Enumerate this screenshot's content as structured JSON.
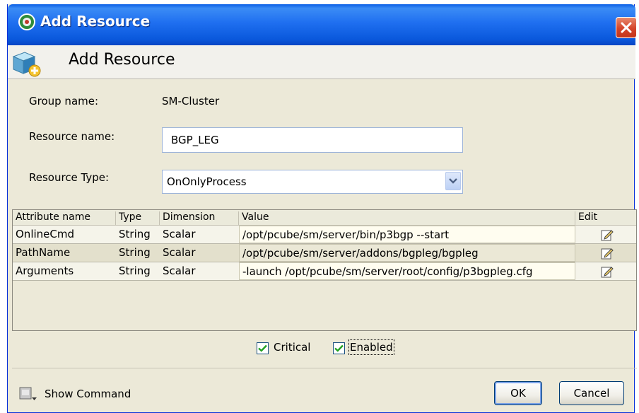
{
  "window": {
    "title": "Add Resource"
  },
  "header": {
    "title": "Add Resource"
  },
  "form": {
    "group_label": "Group name:",
    "group_value": "SM-Cluster",
    "resource_name_label": "Resource name:",
    "resource_name_value": "BGP_LEG",
    "resource_type_label": "Resource Type:",
    "resource_type_value": "OnOnlyProcess"
  },
  "table": {
    "columns": [
      "Attribute name",
      "Type",
      "Dimension",
      "Value",
      "Edit"
    ],
    "rows": [
      {
        "name": "OnlineCmd",
        "type": "String",
        "dimension": "Scalar",
        "value": "/opt/pcube/sm/server/bin/p3bgp --start"
      },
      {
        "name": "PathName",
        "type": "String",
        "dimension": "Scalar",
        "value": "/opt/pcube/sm/server/addons/bgpleg/bgpleg"
      },
      {
        "name": "Arguments",
        "type": "String",
        "dimension": "Scalar",
        "value": "-launch /opt/pcube/sm/server/root/config/p3bgpleg.cfg"
      }
    ]
  },
  "options": {
    "critical_label": "Critical",
    "critical_checked": true,
    "enabled_label": "Enabled",
    "enabled_checked": true
  },
  "footer": {
    "show_command_label": "Show Command",
    "ok_label": "OK",
    "cancel_label": "Cancel"
  },
  "colors": {
    "titlebar": "#0a58dc",
    "close": "#d5442a",
    "check": "#21a121"
  },
  "icons": [
    "app-gear-icon",
    "close-icon",
    "add-resource-cube-icon",
    "edit-pencil-icon",
    "show-command-icon",
    "dropdown-arrow-icon",
    "checkmark-icon"
  ]
}
